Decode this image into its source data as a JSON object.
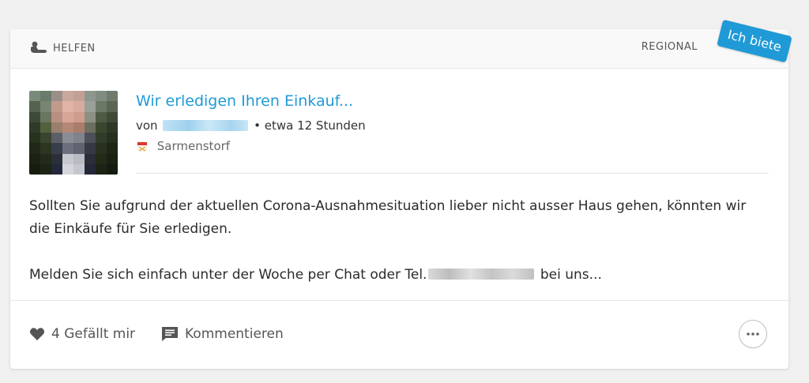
{
  "header": {
    "category_icon": "helping-hand-icon",
    "category": "HELFEN",
    "region": "REGIONAL",
    "badge": "Ich biete",
    "badge_color": "#1f9ad6"
  },
  "post": {
    "avatar_icon": "user-avatar",
    "title": "Wir erledigen Ihren Einkauf...",
    "by_prefix": "von",
    "time": "• etwa 12 Stunden",
    "location_icon": "municipality-flag-icon",
    "location": "Sarmenstorf",
    "body_line_1": "Sollten Sie aufgrund der aktuellen Corona-Ausnahmesituation lieber nicht ausser Haus gehen, könnten wir die Einkäufe für Sie erledigen.",
    "body_line_2_prefix": "Melden Sie sich einfach unter der Woche per Chat oder Tel.",
    "body_line_2_suffix": "bei uns..."
  },
  "footer": {
    "like_icon": "heart-icon",
    "like_label": "4 Gefällt mir",
    "comment_icon": "comment-icon",
    "comment_label": "Kommentieren",
    "more_icon": "more-dots-icon"
  }
}
